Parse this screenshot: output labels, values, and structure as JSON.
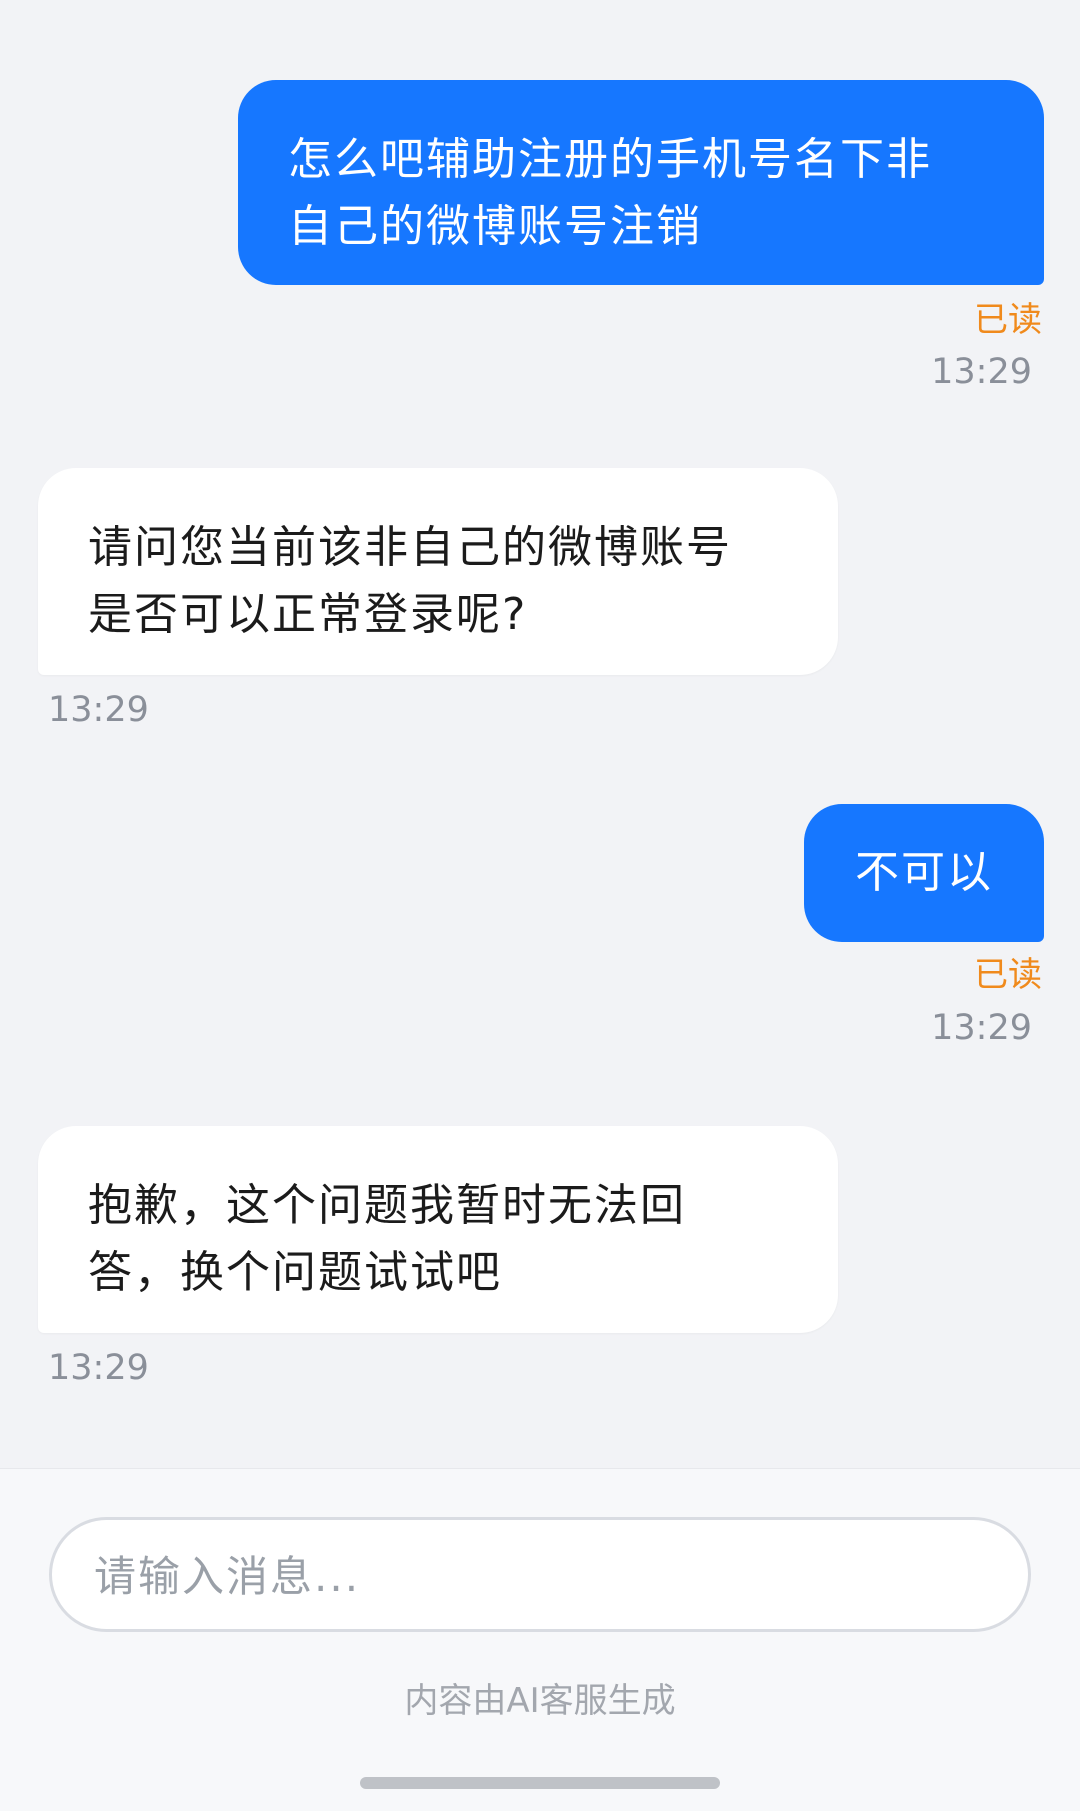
{
  "messages": [
    {
      "side": "outgoing",
      "lines": [
        "怎么吧辅助注册的手机号名下非",
        "自己的微博账号注销"
      ],
      "status": "已读",
      "time": "13:29"
    },
    {
      "side": "incoming",
      "lines": [
        "请问您当前该非自己的微博账号",
        "是否可以正常登录呢?"
      ],
      "time": "13:29"
    },
    {
      "side": "outgoing",
      "lines": [
        "不可以"
      ],
      "status": "已读",
      "time": "13:29"
    },
    {
      "side": "incoming",
      "lines": [
        "抱歉，这个问题我暂时无法回",
        "答，换个问题试试吧"
      ],
      "time": "13:29"
    }
  ],
  "composer": {
    "placeholder": "请输入消息...",
    "value": ""
  },
  "footer": {
    "disclaimer": "内容由AI客服生成"
  },
  "colors": {
    "outgoing_bubble": "#1677ff",
    "incoming_bubble": "#ffffff",
    "read_status": "#f08a1c",
    "background": "#f2f3f6"
  }
}
